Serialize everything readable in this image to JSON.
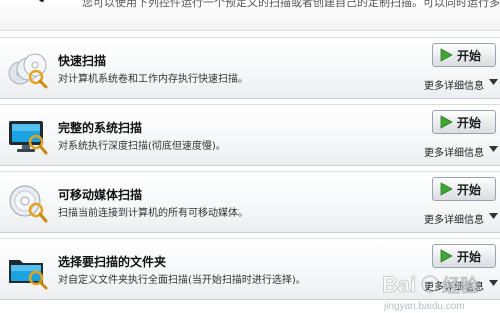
{
  "header": {
    "text": "您可以使用下列控件运行一个预定义的扫描或者创建自己的定制扫描。可以同时运行多个扫描。"
  },
  "scans": [
    {
      "title": "快速扫描",
      "description": "对计算机系统卷和工作内存执行快速扫描。",
      "start_label": "开始",
      "more_label": "更多详细信息",
      "icon": "quick-scan-discs-icon"
    },
    {
      "title": "完整的系统扫描",
      "description": "对系统执行深度扫描(彻底但速度慢)。",
      "start_label": "开始",
      "more_label": "更多详细信息",
      "icon": "monitor-scan-icon"
    },
    {
      "title": "可移动媒体扫描",
      "description": "扫描当前连接到计算机的所有可移动媒体。",
      "start_label": "开始",
      "more_label": "更多详细信息",
      "icon": "removable-media-icon"
    },
    {
      "title": "选择要扫描的文件夹",
      "description": "对自定义文件夹执行全面扫描(当开始扫描时进行选择)。",
      "start_label": "开始",
      "more_label": "更多详细信息",
      "icon": "folder-scan-icon"
    }
  ],
  "watermark": {
    "brand": "Bai",
    "brand2": "经验",
    "url": "jingyan.baidu.com"
  },
  "colors": {
    "play_green": "#3fa535",
    "title_text": "#111111",
    "card_border": "#c9ced4",
    "monitor_blue": "#1aa3e0"
  }
}
